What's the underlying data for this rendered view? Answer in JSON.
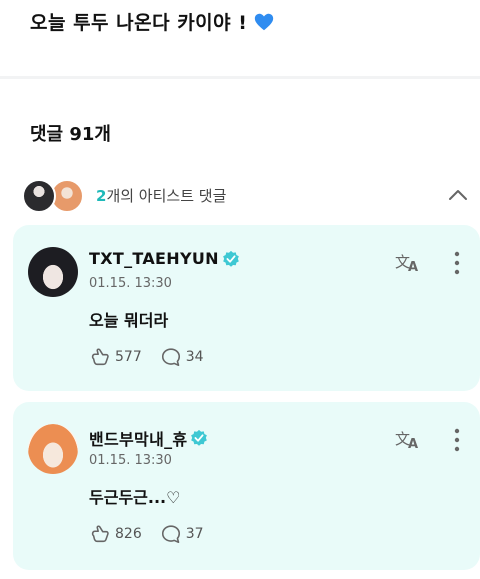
{
  "post": {
    "text": "오늘 투두 나온다 카이야 !",
    "emoji": "blue-heart-icon"
  },
  "comments_header": {
    "label": "댓글 91개"
  },
  "artist_comments": {
    "count": "2",
    "label": "개의 아티스트 댓글"
  },
  "comments": [
    {
      "author": "TXT_TAEHYUN",
      "timestamp": "01.15. 13:30",
      "body": "오늘 뭐더라",
      "likes": "577",
      "replies": "34"
    },
    {
      "author": "밴드부막내_휴",
      "timestamp": "01.15. 13:30",
      "body": "두근두근...♡",
      "likes": "826",
      "replies": "37"
    }
  ],
  "colors": {
    "accent": "#1fb9b9",
    "card_bg": "#e9fbf9",
    "verified": "#3ec8d3"
  }
}
